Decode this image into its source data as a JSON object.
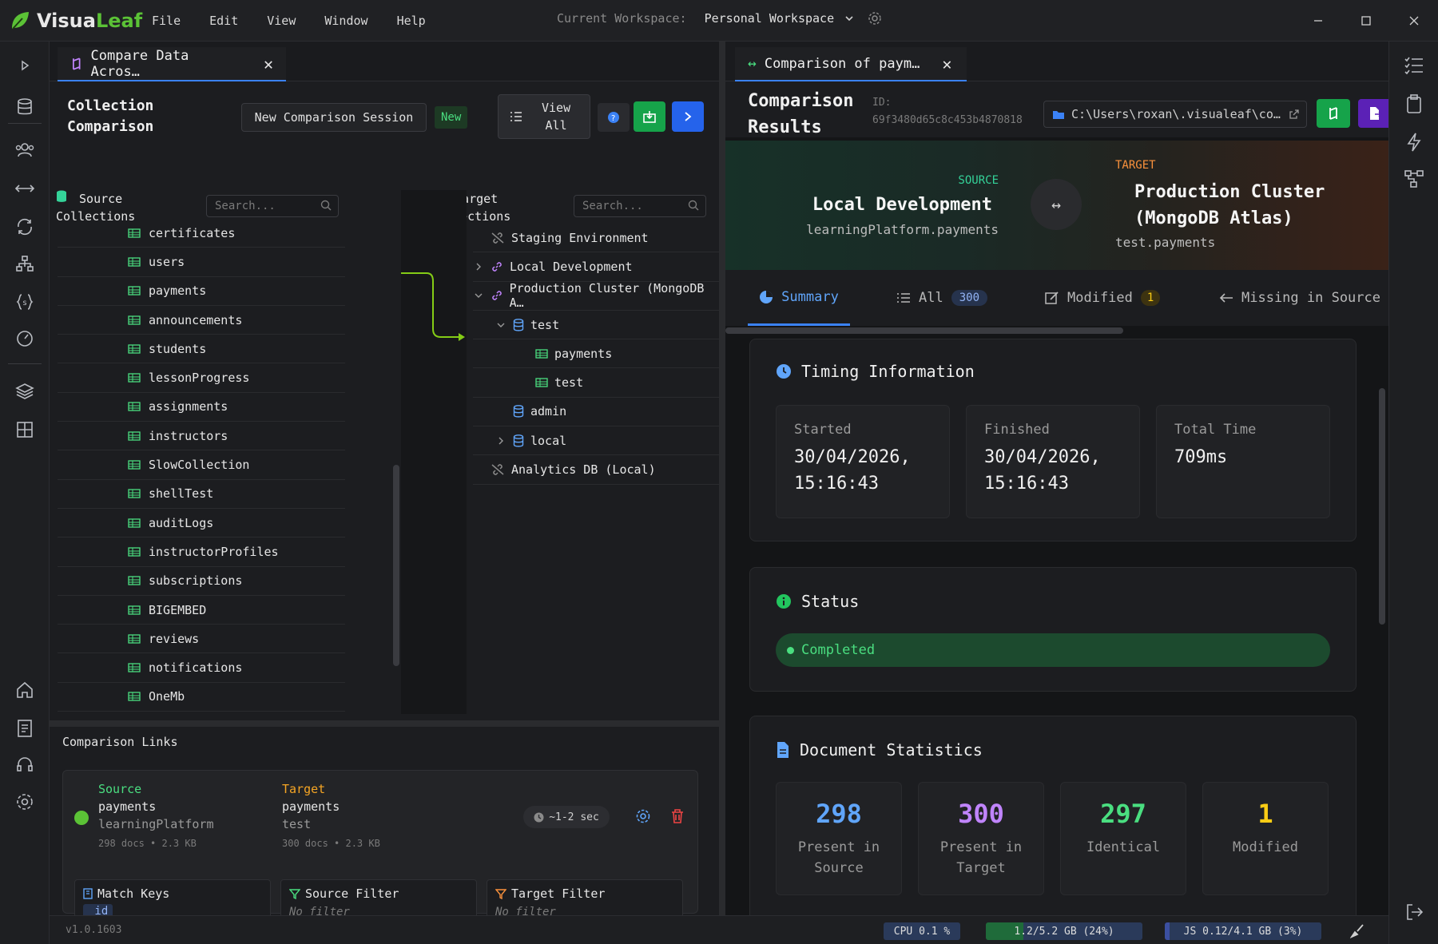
{
  "app": {
    "logo_part1": "Visua",
    "logo_part2": "Leaf",
    "accent": "#5bc236"
  },
  "menu": [
    "File",
    "Edit",
    "View",
    "Window",
    "Help"
  ],
  "workspace": {
    "label": "Current Workspace:",
    "value": "Personal Workspace"
  },
  "left_tab": {
    "title": "Compare Data Acros…"
  },
  "left_toolbar": {
    "title_line1": "Collection",
    "title_line2": "Comparison",
    "session_button": "New Comparison Session",
    "new_badge": "New",
    "view_all_line1": "View",
    "view_all_line2": "All"
  },
  "source_header": {
    "line1": "Source",
    "line2": "Collections",
    "search_placeholder": "Search..."
  },
  "target_header": {
    "line1": "Target",
    "line2": "Collections",
    "search_placeholder": "Search..."
  },
  "source_collections": [
    "certificates",
    "users",
    "payments",
    "announcements",
    "students",
    "lessonProgress",
    "assignments",
    "instructors",
    "SlowCollection",
    "shellTest",
    "auditLogs",
    "instructorProfiles",
    "subscriptions",
    "BIGEMBED",
    "reviews",
    "notifications",
    "OneMb"
  ],
  "target_tree": [
    {
      "label": "Staging Environment",
      "level": 0,
      "icon": "disconnected-icon",
      "chevron": ""
    },
    {
      "label": "Local Development",
      "level": 0,
      "icon": "link-icon",
      "chevron": "›"
    },
    {
      "label": "Production Cluster (MongoDB A…",
      "level": 0,
      "icon": "link-icon",
      "chevron": "⌄"
    },
    {
      "label": "test",
      "level": 1,
      "icon": "database-icon",
      "chevron": "⌄"
    },
    {
      "label": "payments",
      "level": 2,
      "icon": "table-icon",
      "chevron": ""
    },
    {
      "label": "test",
      "level": 2,
      "icon": "table-icon",
      "chevron": ""
    },
    {
      "label": "admin",
      "level": 1,
      "icon": "database-icon",
      "chevron": ""
    },
    {
      "label": "local",
      "level": 1,
      "icon": "database-icon",
      "chevron": "›"
    },
    {
      "label": "Analytics DB (Local)",
      "level": 0,
      "icon": "disconnected-icon",
      "chevron": ""
    }
  ],
  "links": {
    "title": "Comparison Links",
    "source_label": "Source",
    "source_collection": "payments",
    "source_db": "learningPlatform",
    "source_meta": "298 docs • 2.3 KB",
    "target_label": "Target",
    "target_collection": "payments",
    "target_db": "test",
    "target_meta": "300 docs • 2.3 KB",
    "time": "~1-2 sec",
    "match_keys_label": "Match Keys",
    "match_keys_value": "_id",
    "source_filter_label": "Source Filter",
    "source_filter_value": "No filter",
    "target_filter_label": "Target Filter",
    "target_filter_value": "No filter"
  },
  "right_tab": {
    "title": "Comparison of paym…"
  },
  "results": {
    "title_line1": "Comparison",
    "title_line2": "Results",
    "id_label": "ID:",
    "id_value": "69f3480d65c8c453b4870818",
    "path": "C:\\Users\\roxan\\.visualeaf\\co…",
    "source_label": "SOURCE",
    "source_name": "Local Development",
    "source_ns": "learningPlatform.payments",
    "target_label": "TARGET",
    "target_name_line1": "Production Cluster",
    "target_name_line2": "(MongoDB Atlas)",
    "target_ns": "test.payments"
  },
  "summary_tabs": {
    "summary": "Summary",
    "all": "All",
    "all_count": "300",
    "modified": "Modified",
    "modified_count": "1",
    "missing": "Missing in Source"
  },
  "timing": {
    "title": "Timing Information",
    "started_label": "Started",
    "started_date": "30/04/2026,",
    "started_time": "15:16:43",
    "finished_label": "Finished",
    "finished_date": "30/04/2026,",
    "finished_time": "15:16:43",
    "total_label": "Total Time",
    "total_value": "709ms"
  },
  "status": {
    "title": "Status",
    "value": "Completed"
  },
  "doc_stats": {
    "title": "Document Statistics",
    "items": [
      {
        "value": "298",
        "line1": "Present in",
        "line2": "Source",
        "color": "#60a5fa"
      },
      {
        "value": "300",
        "line1": "Present in",
        "line2": "Target",
        "color": "#c084fc"
      },
      {
        "value": "297",
        "line1": "Identical",
        "line2": "",
        "color": "#4ade80"
      },
      {
        "value": "1",
        "line1": "Modified",
        "line2": "",
        "color": "#facc15"
      }
    ]
  },
  "statusbar": {
    "version": "v1.0.1603",
    "cpu": "CPU 0.1 %",
    "mem": "1.2/5.2 GB (24%)",
    "js": "JS 0.12/4.1 GB (3%)"
  }
}
